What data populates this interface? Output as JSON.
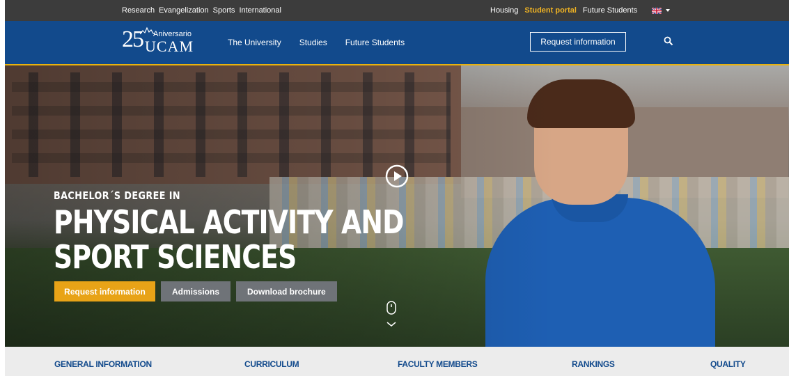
{
  "topbar": {
    "left_links": [
      "Research",
      "Evangelization",
      "Sports",
      "International"
    ],
    "right_links": [
      {
        "label": "Housing",
        "highlight": false
      },
      {
        "label": "Student portal",
        "highlight": true
      },
      {
        "label": "Future Students",
        "highlight": false
      }
    ],
    "language_icon": "uk-flag-icon"
  },
  "header": {
    "logo": {
      "number": "25",
      "anniversary": "Aniversario",
      "brand": "UCAM"
    },
    "nav": [
      "The University",
      "Studies",
      "Future Students"
    ],
    "request_button": "Request information",
    "search_icon": "search-icon"
  },
  "hero": {
    "subtitle": "BACHELOR´S DEGREE IN",
    "title_line1": "PHYSICAL ACTIVITY AND",
    "title_line2": "SPORT SCIENCES",
    "buttons": {
      "request": "Request information",
      "admissions": "Admissions",
      "brochure": "Download brochure"
    },
    "play_icon": "play-icon",
    "scroll_icon": "mouse-scroll-icon"
  },
  "tabs": [
    "GENERAL INFORMATION",
    "CURRICULUM",
    "FACULTY MEMBERS",
    "RANKINGS",
    "QUALITY"
  ],
  "colors": {
    "topbar": "#3c3c3c",
    "navbar": "#124a8c",
    "accent": "#e8a317",
    "highlight_link": "#f0b323",
    "tab_text": "#124a8c"
  }
}
